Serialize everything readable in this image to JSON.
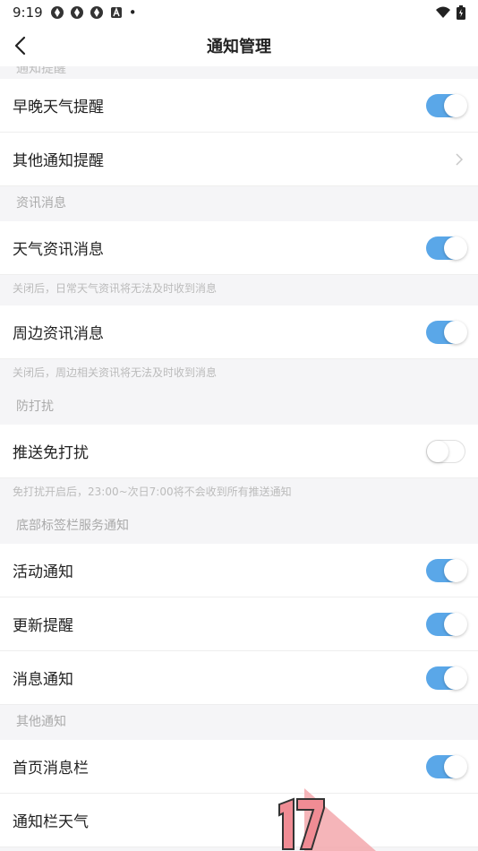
{
  "status_bar": {
    "time": "9:19",
    "dot": "•"
  },
  "header": {
    "title": "通知管理"
  },
  "clipped_section": "通知提醒",
  "rows": {
    "morning_evening_weather": {
      "label": "早晚天气提醒",
      "on": true
    },
    "other_notification": {
      "label": "其他通知提醒"
    },
    "weather_news": {
      "label": "天气资讯消息",
      "on": true
    },
    "nearby_news": {
      "label": "周边资讯消息",
      "on": true
    },
    "push_dnd": {
      "label": "推送免打扰",
      "on": false
    },
    "activity": {
      "label": "活动通知",
      "on": true
    },
    "update": {
      "label": "更新提醒",
      "on": true
    },
    "message": {
      "label": "消息通知",
      "on": true
    },
    "home_message_bar": {
      "label": "首页消息栏",
      "on": true
    },
    "notification_weather": {
      "label": "通知栏天气"
    }
  },
  "sections": {
    "news": "资讯消息",
    "dnd": "防打扰",
    "bottom_tabs": "底部标签栏服务通知",
    "other": "其他通知"
  },
  "notes": {
    "weather_news": "关闭后，日常天气资讯将无法及时收到消息",
    "nearby_news": "关闭后，周边相关资讯将无法及时收到消息",
    "dnd": "免打扰开启后，23:00~次日7:00将不会收到所有推送通知"
  },
  "colors": {
    "toggle_on": "#5aa7e8",
    "background": "#f5f5f7"
  },
  "icons": {
    "back": "chevron-left-icon",
    "chevron": "chevron-right-icon",
    "wifi": "wifi-icon",
    "battery": "battery-icon"
  }
}
